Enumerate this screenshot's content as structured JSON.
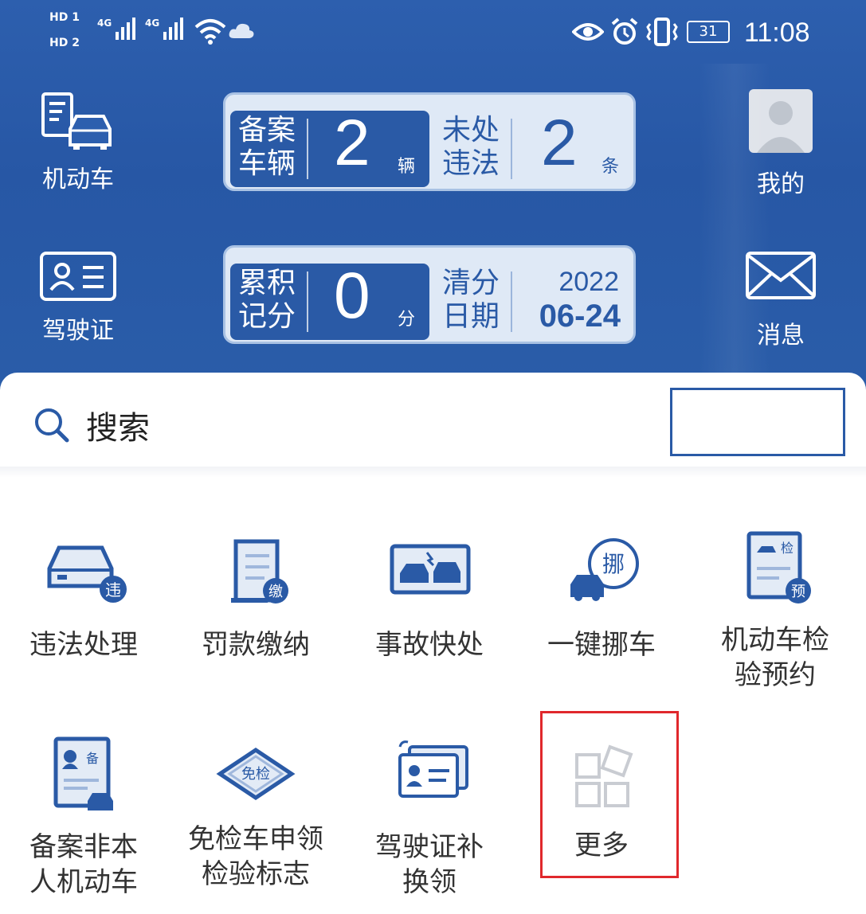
{
  "status_bar": {
    "sim1": "HD 1",
    "sim2": "HD 2",
    "net1": "4G",
    "net2": "4G",
    "battery": "31",
    "time": "11:08"
  },
  "header": {
    "left_items": [
      {
        "label": "机动车",
        "icon": "car-document-icon"
      },
      {
        "label": "驾驶证",
        "icon": "license-card-icon"
      }
    ],
    "right_items": [
      {
        "label": "我的",
        "icon": "avatar-icon"
      },
      {
        "label": "消息",
        "icon": "envelope-icon"
      }
    ],
    "panel1": {
      "dark_label": "备案车辆",
      "dark_value": "2",
      "dark_unit": "辆",
      "light_label": "未处违法",
      "light_value": "2",
      "light_unit": "条"
    },
    "panel2": {
      "dark_label": "累积记分",
      "dark_value": "0",
      "dark_unit": "分",
      "light_label": "清分日期",
      "year": "2022",
      "date": "06-24"
    }
  },
  "search": {
    "label": "搜索",
    "icon": "search-icon"
  },
  "services": [
    {
      "label": "违法处理",
      "icon": "violation-car-icon",
      "badge": "违"
    },
    {
      "label": "罚款缴纳",
      "icon": "fine-scroll-icon",
      "badge": "缴"
    },
    {
      "label": "事故快处",
      "icon": "accident-icon"
    },
    {
      "label": "一键挪车",
      "icon": "move-car-icon",
      "badge": "挪"
    },
    {
      "label": "机动车检验预约",
      "label_line1": "机动车检",
      "label_line2": "验预约",
      "icon": "inspection-icon",
      "badge1": "检",
      "badge2": "预"
    },
    {
      "label_line1": "备案非本",
      "label_line2": "人机动车",
      "icon": "registration-icon",
      "badge": "备"
    },
    {
      "label_line1": "免检车申领",
      "label_line2": "检验标志",
      "icon": "exempt-tag-icon",
      "badge": "免检"
    },
    {
      "label_line1": "驾驶证补",
      "label_line2": "换领",
      "icon": "license-renew-icon"
    },
    {
      "label": "更多",
      "icon": "more-grid-icon"
    }
  ],
  "colors": {
    "header_blue": "#2a5aa6",
    "panel_light": "#dfe9f6",
    "highlight_red": "#e0282c"
  }
}
